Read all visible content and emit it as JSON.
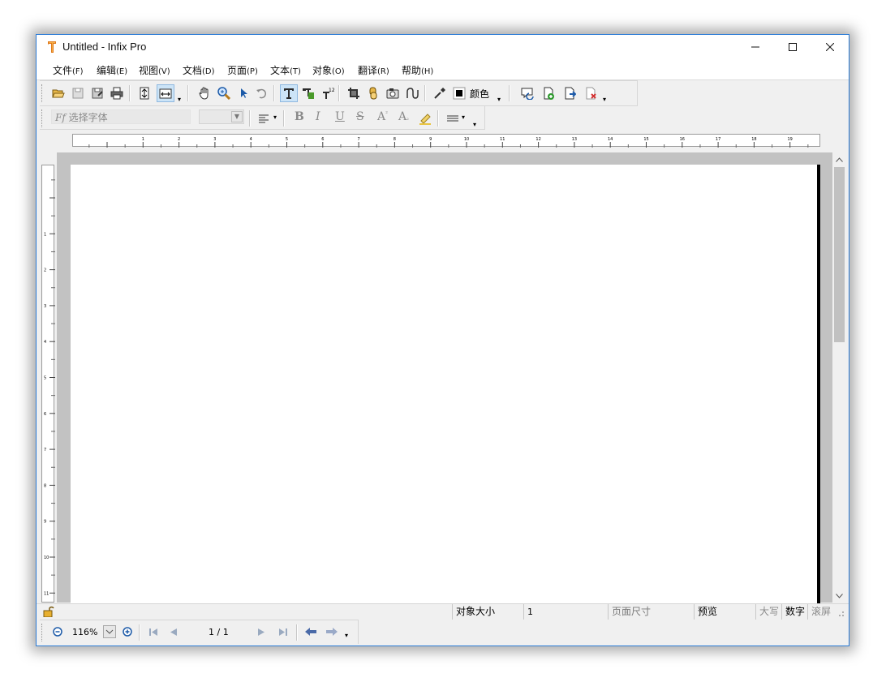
{
  "window": {
    "title": "Untitled - Infix Pro",
    "accent": "#2b7bd6"
  },
  "menu": [
    {
      "label": "文件",
      "key": "(F)"
    },
    {
      "label": "编辑",
      "key": "(E)"
    },
    {
      "label": "视图",
      "key": "(V)"
    },
    {
      "label": "文档",
      "key": "(D)"
    },
    {
      "label": "页面",
      "key": "(P)"
    },
    {
      "label": "文本",
      "key": "(T)"
    },
    {
      "label": "对象",
      "key": "(O)"
    },
    {
      "label": "翻译",
      "key": "(R)"
    },
    {
      "label": "帮助",
      "key": "(H)"
    }
  ],
  "toolbar": {
    "color_label": "颜色",
    "font_placeholder": "选择字体",
    "font_prefix": "Ff"
  },
  "format": {
    "bold": "B",
    "italic": "I",
    "underline": "U",
    "strike": "S",
    "superscript": "A",
    "superscript_mark": "²",
    "subscript": "A",
    "subscript_mark": "₂"
  },
  "ruler": {
    "horizontal": [
      "1",
      "2",
      "3",
      "4",
      "5",
      "6",
      "7",
      "8",
      "9",
      "10",
      "11",
      "12",
      "13",
      "14",
      "15",
      "16",
      "17",
      "18",
      "19",
      "20"
    ],
    "vertical": [
      "1",
      "2",
      "3",
      "4",
      "5",
      "6",
      "7",
      "8",
      "9",
      "10",
      "11",
      "12"
    ]
  },
  "status": {
    "object_size_label": "对象大小",
    "object_size_value": "1",
    "page_size_label": "页面尺寸",
    "preview": "预览",
    "caps": "大写",
    "num": "数字",
    "scroll": "滚屏"
  },
  "nav": {
    "zoom": "116%",
    "page": "1 / 1"
  }
}
